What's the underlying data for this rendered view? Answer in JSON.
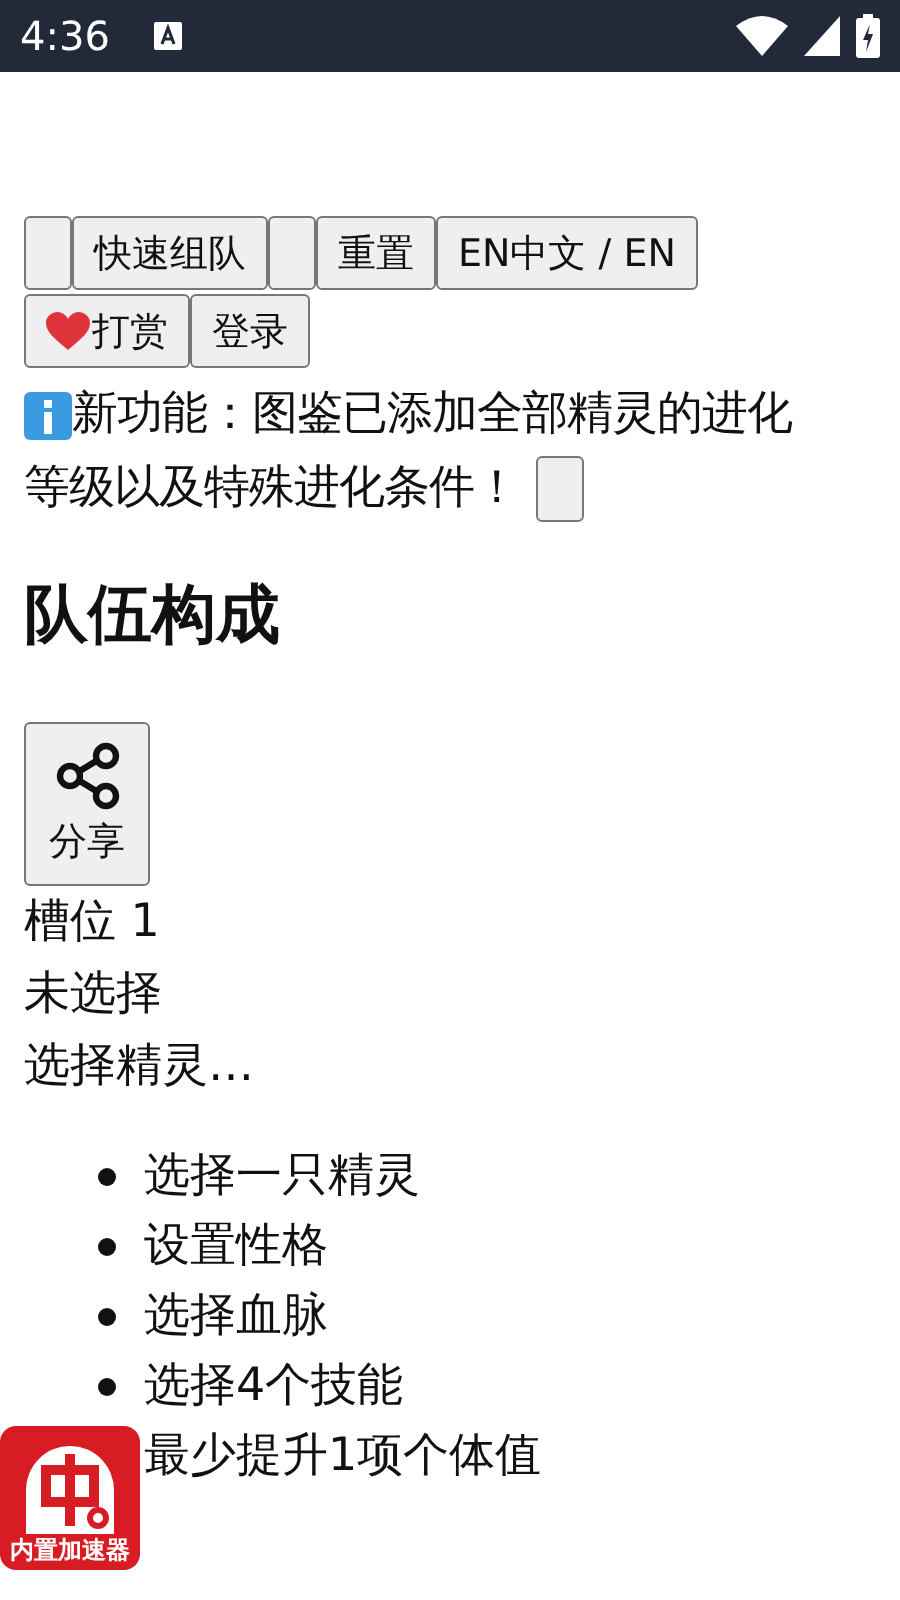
{
  "status_bar": {
    "time": "4:36"
  },
  "page": {
    "toolbar_buttons": [
      {
        "kind": "blank"
      },
      {
        "kind": "text",
        "label": "快速组队"
      },
      {
        "kind": "blank"
      },
      {
        "kind": "text",
        "label": "重置"
      },
      {
        "kind": "text",
        "label": "EN中文 / EN"
      },
      {
        "kind": "heart",
        "label": "打赏"
      },
      {
        "kind": "text",
        "label": "登录"
      }
    ],
    "notice": {
      "lines": [
        "新功能：图鉴已添加全部精灵的进化",
        "等级以及特殊进化条件！"
      ]
    },
    "section_title": "队伍构成",
    "share_button": {
      "label": "分享"
    },
    "slots": [
      {
        "title": "槽位 1",
        "status": "未选择",
        "prompt": "选择精灵…",
        "steps": [
          "选择一只精灵",
          "设置性格",
          "选择血脉",
          "选择4个技能",
          "最少提升1项个体值"
        ]
      }
    ]
  },
  "overlay": {
    "label": "内置加速器"
  }
}
